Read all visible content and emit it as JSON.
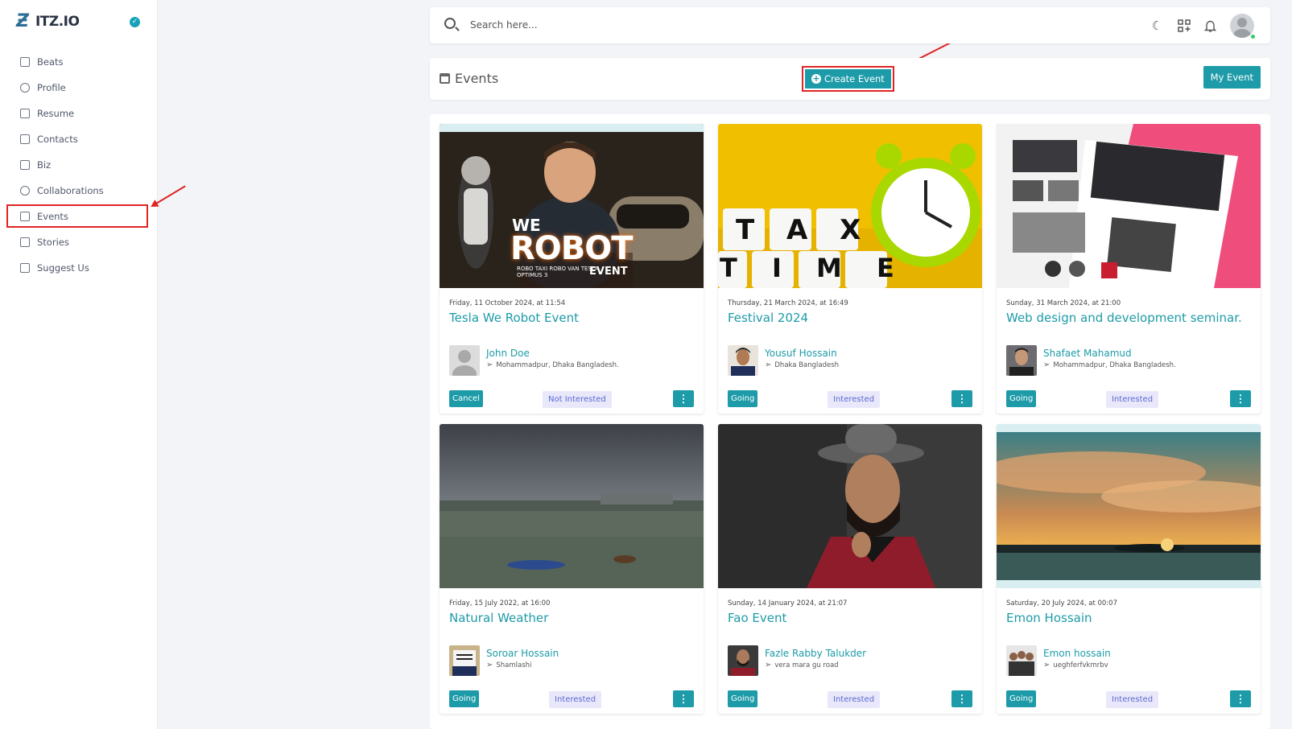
{
  "brand": {
    "name": "ITZ.IO",
    "mark": "Ƶ"
  },
  "sidebar": {
    "items": [
      {
        "label": "Beats",
        "icon": "grid-icon"
      },
      {
        "label": "Profile",
        "icon": "user-icon"
      },
      {
        "label": "Resume",
        "icon": "file-icon"
      },
      {
        "label": "Contacts",
        "icon": "contacts-icon"
      },
      {
        "label": "Biz",
        "icon": "clipboard-icon"
      },
      {
        "label": "Collaborations",
        "icon": "people-icon"
      },
      {
        "label": "Events",
        "icon": "calendar-icon",
        "active": true
      },
      {
        "label": "Stories",
        "icon": "stories-icon"
      },
      {
        "label": "Suggest Us",
        "icon": "suggest-icon"
      }
    ]
  },
  "search": {
    "placeholder": "Search here...",
    "value": ""
  },
  "topbar_icons": [
    "moon-icon",
    "apps-icon",
    "bell-icon",
    "avatar"
  ],
  "events_header": {
    "title": "Events",
    "create_label": "Create Event",
    "my_label": "My Event"
  },
  "colors": {
    "accent": "#1d9ba8",
    "annotation": "#e02424",
    "interest_bg": "#e9e8fb"
  },
  "events": [
    {
      "date": "Friday, 11 October 2024, at 11:54",
      "title": "Tesla We Robot Event",
      "organizer": "John Doe",
      "location": "Mohammadpur, Dhaka Bangladesh.",
      "status_label": "Cancel",
      "interest_label": "Not Interested",
      "image_text_1": "WE",
      "image_text_2": "ROBOT",
      "image_text_3": "EVENT",
      "image_text_4": "ROBO TAXI ROBO VAN TESLA OPTIMUS 3"
    },
    {
      "date": "Thursday, 21 March 2024, at 16:49",
      "title": "Festival 2024",
      "organizer": "Yousuf Hossain",
      "location": "Dhaka Bangladesh",
      "status_label": "Going",
      "interest_label": "Interested",
      "image_text_1": "T A X",
      "image_text_2": "T I M E"
    },
    {
      "date": "Sunday, 31 March 2024, at 21:00",
      "title": "Web design and development seminar.",
      "organizer": "Shafaet Mahamud",
      "location": "Mohammadpur, Dhaka Bangladesh.",
      "status_label": "Going",
      "interest_label": "Interested"
    },
    {
      "date": "Friday, 15 July 2022, at 16:00",
      "title": "Natural Weather",
      "organizer": "Soroar Hossain",
      "location": "Shamlashi",
      "status_label": "Going",
      "interest_label": "Interested"
    },
    {
      "date": "Sunday, 14 January 2024, at 21:07",
      "title": "Fao Event",
      "organizer": "Fazle Rabby Talukder",
      "location": "vera mara gu road",
      "status_label": "Going",
      "interest_label": "Interested"
    },
    {
      "date": "Saturday, 20 July 2024, at 00:07",
      "title": "Emon Hossain",
      "organizer": "Emon hossain",
      "location": "ueghferfvkmrbv",
      "status_label": "Going",
      "interest_label": "Interested"
    }
  ]
}
